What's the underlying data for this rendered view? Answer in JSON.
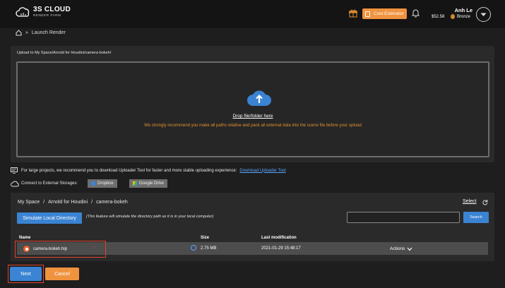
{
  "header": {
    "logo_main": "3S CLOUD",
    "logo_sub": "RENDER FARM",
    "cost_estimator_label": "Cost Estimator",
    "user_name": "Anh Le",
    "balance": "$52.58",
    "tier": "Bronze"
  },
  "breadcrumb": {
    "separator": "»",
    "current": "Launch Render"
  },
  "upload": {
    "path_label": "Upload to My Space/Arnold for Houdini/camera-bokeh/",
    "drop_label": "Drop file/folder here",
    "warning": "We strongly recommend you make all paths relative and pack all external data into the scene file before your upload"
  },
  "uploader_notice": {
    "text": "For large projects, we recommend you to download Uploader Tool for faster and more stable uploading experience:",
    "link": "Download Uploader Tool"
  },
  "external": {
    "label": "Connect to External Storages:",
    "dropbox": "Dropbox",
    "gdrive": "Google Drive"
  },
  "browser": {
    "path": [
      "My Space",
      "/",
      "Arnold for Houdini",
      "/",
      "camera-bokeh"
    ],
    "select_label": "Select",
    "simulate_label": "Simulate Local Directory",
    "simulate_note": "(This feature will simulate the directory path as it is in your local computer)",
    "search_label": "Search",
    "columns": {
      "name": "Name",
      "size": "Size",
      "modified": "Last modification"
    },
    "rows": [
      {
        "name": "camera-bokeh.hip",
        "size": "2.75 MB",
        "modified": "2021-01-29 15:48:17",
        "actions": "Actions"
      }
    ]
  },
  "footer": {
    "next_label": "Next",
    "cancel_label": "Cancel"
  },
  "colors": {
    "accent_blue": "#3b83d3",
    "accent_orange": "#f0933f",
    "highlight_red": "#e0432d"
  }
}
